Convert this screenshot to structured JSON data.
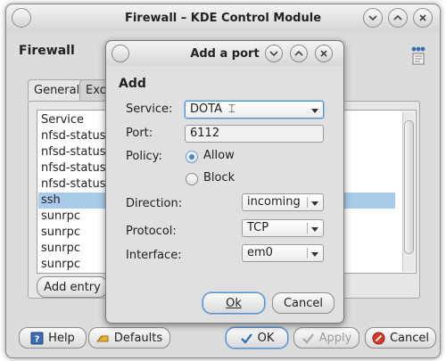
{
  "window": {
    "title": "Firewall – KDE Control Module",
    "heading": "Firewall",
    "tabs": [
      {
        "label": "General"
      },
      {
        "label": "Exc"
      }
    ],
    "list": {
      "header": "Service",
      "rows": [
        "nfsd-status",
        "nfsd-status",
        "nfsd-status",
        "nfsd-status",
        "ssh",
        "sunrpc",
        "sunrpc",
        "sunrpc",
        "sunrpc"
      ],
      "selected_index": 4
    },
    "add_entry_label": "Add entry",
    "buttons": {
      "help": "Help",
      "defaults": "Defaults",
      "ok": "OK",
      "apply": "Apply",
      "cancel": "Cancel"
    }
  },
  "dialog": {
    "title": "Add a port",
    "heading": "Add",
    "service": {
      "label": "Service:",
      "value": "DOTA"
    },
    "port": {
      "label": "Port:",
      "value": "6112"
    },
    "policy": {
      "label": "Policy:",
      "options": [
        "Allow",
        "Block"
      ],
      "selected": "Allow"
    },
    "direction": {
      "label": "Direction:",
      "value": "incoming"
    },
    "protocol": {
      "label": "Protocol:",
      "value": "TCP"
    },
    "interface": {
      "label": "Interface:",
      "value": "em0"
    },
    "ok_label": "Ok",
    "cancel_label": "Cancel"
  },
  "colors": {
    "selection": "#a9cbea",
    "accent": "#4a86c5",
    "window_bg": "#dcdcdc"
  },
  "icons": {
    "titlebar": [
      "menu-icon",
      "minimize-icon",
      "maximize-icon",
      "close-icon"
    ],
    "module": "firewall-module-icon",
    "help": "help-icon",
    "defaults": "defaults-icon",
    "ok": "checkmark-icon",
    "apply": "checkmark-icon",
    "cancel": "cancel-icon"
  }
}
